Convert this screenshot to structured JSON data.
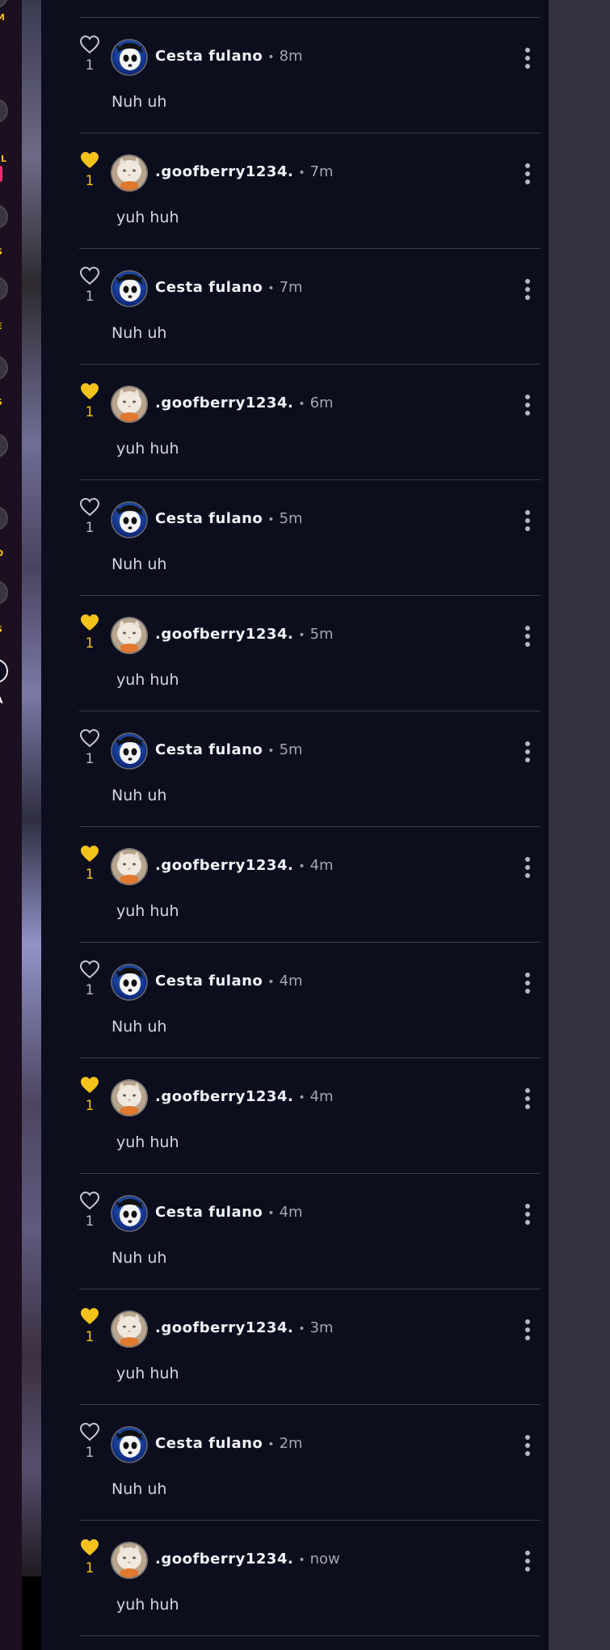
{
  "rail": {
    "items": [
      {
        "label": "M",
        "active": false
      },
      {
        "label": "AL",
        "active": false
      },
      {
        "label": "S",
        "active": false
      },
      {
        "label": "E",
        "active": false
      },
      {
        "label": "S",
        "active": false
      },
      {
        "label": "",
        "active": false
      },
      {
        "label": "D",
        "active": false
      },
      {
        "label": "S",
        "active": false
      },
      {
        "label": "A",
        "active": true
      }
    ]
  },
  "colors": {
    "accent_liked": "#f4c21b",
    "heart_outline": "#c5c6cf",
    "background": "#0c0e1e",
    "divider": "#3a3c4d"
  },
  "comments": [
    {
      "author": "Cesta fulano",
      "time": "8m",
      "likes": "1",
      "liked": false,
      "text": "Nuh uh",
      "avatar": "cesta-avatar"
    },
    {
      "author": ".goofberry1234.",
      "time": "7m",
      "likes": "1",
      "liked": true,
      "text": "yuh huh",
      "avatar": "goofberry-avatar"
    },
    {
      "author": "Cesta fulano",
      "time": "7m",
      "likes": "1",
      "liked": false,
      "text": "Nuh uh",
      "avatar": "cesta-avatar"
    },
    {
      "author": ".goofberry1234.",
      "time": "6m",
      "likes": "1",
      "liked": true,
      "text": "yuh huh",
      "avatar": "goofberry-avatar"
    },
    {
      "author": "Cesta fulano",
      "time": "5m",
      "likes": "1",
      "liked": false,
      "text": "Nuh uh",
      "avatar": "cesta-avatar"
    },
    {
      "author": ".goofberry1234.",
      "time": "5m",
      "likes": "1",
      "liked": true,
      "text": "yuh huh",
      "avatar": "goofberry-avatar"
    },
    {
      "author": "Cesta fulano",
      "time": "5m",
      "likes": "1",
      "liked": false,
      "text": "Nuh uh",
      "avatar": "cesta-avatar"
    },
    {
      "author": ".goofberry1234.",
      "time": "4m",
      "likes": "1",
      "liked": true,
      "text": "yuh huh",
      "avatar": "goofberry-avatar"
    },
    {
      "author": "Cesta fulano",
      "time": "4m",
      "likes": "1",
      "liked": false,
      "text": "Nuh uh",
      "avatar": "cesta-avatar"
    },
    {
      "author": ".goofberry1234.",
      "time": "4m",
      "likes": "1",
      "liked": true,
      "text": "yuh huh",
      "avatar": "goofberry-avatar"
    },
    {
      "author": "Cesta fulano",
      "time": "4m",
      "likes": "1",
      "liked": false,
      "text": "Nuh uh",
      "avatar": "cesta-avatar"
    },
    {
      "author": ".goofberry1234.",
      "time": "3m",
      "likes": "1",
      "liked": true,
      "text": "yuh huh",
      "avatar": "goofberry-avatar"
    },
    {
      "author": "Cesta fulano",
      "time": "2m",
      "likes": "1",
      "liked": false,
      "text": "Nuh uh",
      "avatar": "cesta-avatar"
    },
    {
      "author": ".goofberry1234.",
      "time": "now",
      "likes": "1",
      "liked": true,
      "text": "yuh huh",
      "avatar": "goofberry-avatar"
    }
  ]
}
